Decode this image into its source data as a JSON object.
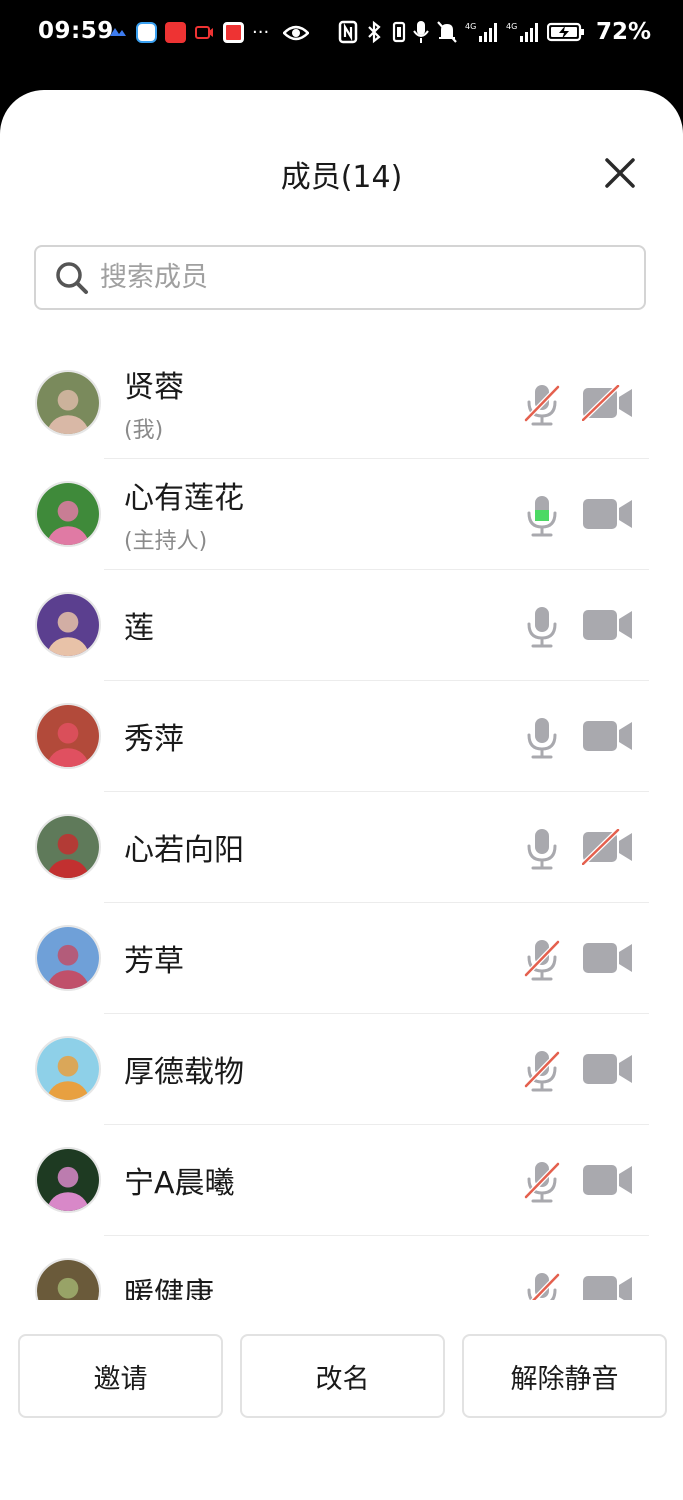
{
  "status_bar": {
    "time": "09:59",
    "battery_percent": "72%",
    "more": "···"
  },
  "panel": {
    "title": "成员(14)",
    "search": {
      "placeholder": "搜索成员",
      "value": ""
    }
  },
  "members": [
    {
      "name": "贤蓉",
      "sub": "(我)",
      "mic": "muted",
      "camera": "off",
      "avatar_colors": [
        "#7a8a5c",
        "#d9b8a6"
      ]
    },
    {
      "name": "心有莲花",
      "sub": "(主持人)",
      "mic": "speaking",
      "camera": "on",
      "avatar_colors": [
        "#3f8a3a",
        "#e07aa4"
      ]
    },
    {
      "name": "莲",
      "sub": "",
      "mic": "on",
      "camera": "on",
      "avatar_colors": [
        "#5b3f8f",
        "#e8c2a8"
      ]
    },
    {
      "name": "秀萍",
      "sub": "",
      "mic": "on",
      "camera": "on",
      "avatar_colors": [
        "#b24a3a",
        "#e05060"
      ]
    },
    {
      "name": "心若向阳",
      "sub": "",
      "mic": "on",
      "camera": "off",
      "avatar_colors": [
        "#5f7a5a",
        "#c23030"
      ]
    },
    {
      "name": "芳草",
      "sub": "",
      "mic": "muted",
      "camera": "on",
      "avatar_colors": [
        "#6fa0d8",
        "#c0506a"
      ]
    },
    {
      "name": "厚德载物",
      "sub": "",
      "mic": "muted",
      "camera": "on",
      "avatar_colors": [
        "#8ed0e8",
        "#e8a040"
      ]
    },
    {
      "name": "宁A晨曦",
      "sub": "",
      "mic": "muted",
      "camera": "on",
      "avatar_colors": [
        "#1e3a22",
        "#d888c8"
      ]
    },
    {
      "name": "暖健康",
      "sub": "",
      "mic": "muted",
      "camera": "on",
      "avatar_colors": [
        "#6a5a3a",
        "#a0b070"
      ]
    }
  ],
  "buttons": {
    "invite": "邀请",
    "rename": "改名",
    "unmute": "解除静音"
  },
  "colors": {
    "icon_gray": "#a9a9ae",
    "mute_slash": "#e4604e",
    "speaking_green": "#4cd964"
  }
}
